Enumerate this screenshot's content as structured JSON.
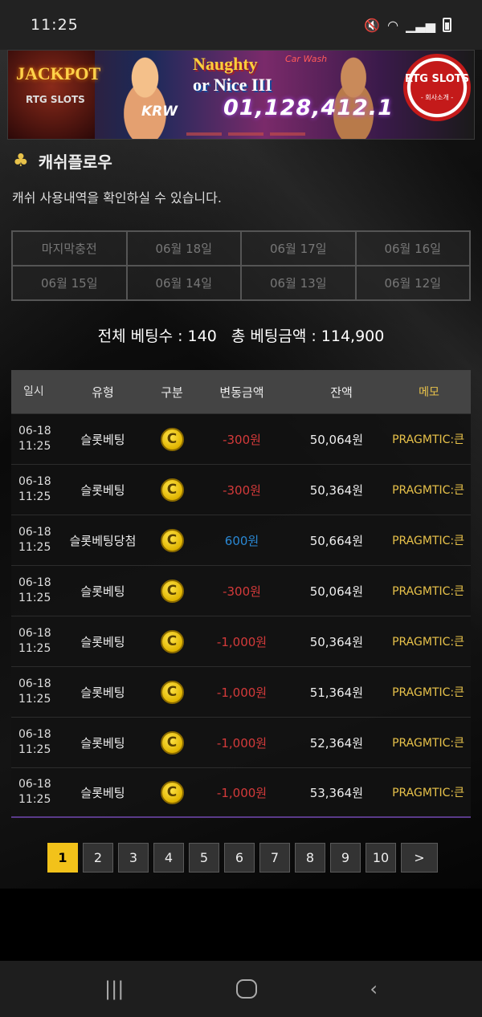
{
  "status_bar": {
    "time": "11:25"
  },
  "banner": {
    "jackpot_label": "JACKPOT",
    "provider_label": "RTG SLOTS",
    "currency": "KRW",
    "game_title_line1": "Naughty",
    "game_title_line2": "or Nice III",
    "game_subtitle": "Car Wash",
    "amount": "01,128,412.1",
    "badge_title": "RTG SLOTS",
    "badge_subtitle": "- 회사소개 -"
  },
  "section": {
    "title": "캐쉬플로우",
    "description": "캐쉬 사용내역을 확인하실 수 있습니다."
  },
  "date_filters": [
    "마지막충전",
    "06월 18일",
    "06월 17일",
    "06월 16일",
    "06월 15일",
    "06월 14일",
    "06월 13일",
    "06월 12일"
  ],
  "summary": {
    "bet_count_label": "전체 베팅수 : 140",
    "bet_amount_label": "총 베팅금액 : 114,900"
  },
  "table": {
    "headers": [
      "일시",
      "유형",
      "구분",
      "변동금액",
      "잔액",
      "메모"
    ],
    "rows": [
      {
        "date": "06-18",
        "time": "11:25",
        "type": "슬롯베팅",
        "change": "-300원",
        "balance": "50,064원",
        "memo": "PRAGMTIC:큰"
      },
      {
        "date": "06-18",
        "time": "11:25",
        "type": "슬롯베팅",
        "change": "-300원",
        "balance": "50,364원",
        "memo": "PRAGMTIC:큰"
      },
      {
        "date": "06-18",
        "time": "11:25",
        "type": "슬롯베팅당첨",
        "change": "600원",
        "balance": "50,664원",
        "memo": "PRAGMTIC:큰"
      },
      {
        "date": "06-18",
        "time": "11:25",
        "type": "슬롯베팅",
        "change": "-300원",
        "balance": "50,064원",
        "memo": "PRAGMTIC:큰"
      },
      {
        "date": "06-18",
        "time": "11:25",
        "type": "슬롯베팅",
        "change": "-1,000원",
        "balance": "50,364원",
        "memo": "PRAGMTIC:큰"
      },
      {
        "date": "06-18",
        "time": "11:25",
        "type": "슬롯베팅",
        "change": "-1,000원",
        "balance": "51,364원",
        "memo": "PRAGMTIC:큰"
      },
      {
        "date": "06-18",
        "time": "11:25",
        "type": "슬롯베팅",
        "change": "-1,000원",
        "balance": "52,364원",
        "memo": "PRAGMTIC:큰"
      },
      {
        "date": "06-18",
        "time": "11:25",
        "type": "슬롯베팅",
        "change": "-1,000원",
        "balance": "53,364원",
        "memo": "PRAGMTIC:큰"
      }
    ],
    "coin_icon_label": "C"
  },
  "pagination": {
    "pages": [
      "1",
      "2",
      "3",
      "4",
      "5",
      "6",
      "7",
      "8",
      "9",
      "10"
    ],
    "next_label": ">",
    "current": "1"
  },
  "colors": {
    "accent": "#f2c21a",
    "negative": "#d43a3a",
    "positive": "#2a88d4",
    "memo": "#e8c24a"
  }
}
